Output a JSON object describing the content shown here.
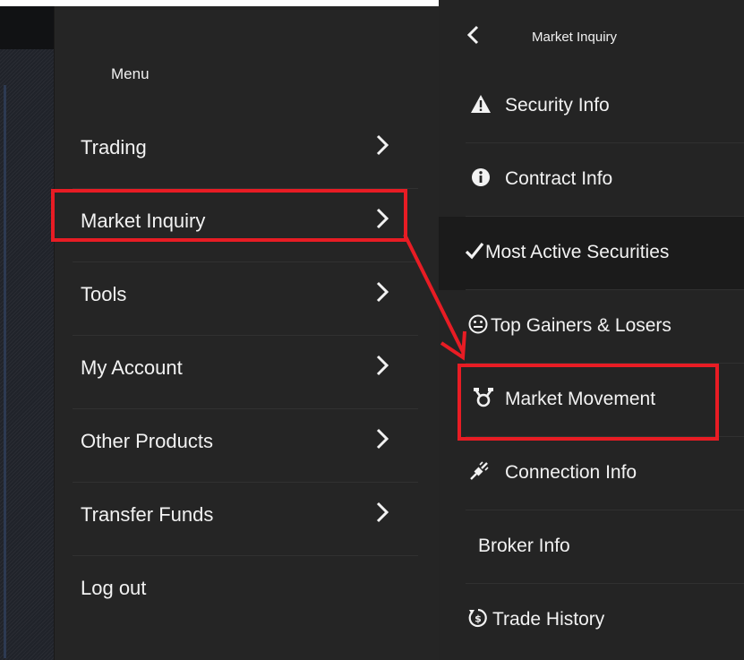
{
  "menu": {
    "title": "Menu",
    "items": [
      {
        "label": "Trading",
        "has_submenu": true
      },
      {
        "label": "Market Inquiry",
        "has_submenu": true,
        "highlighted": true
      },
      {
        "label": "Tools",
        "has_submenu": true
      },
      {
        "label": "My Account",
        "has_submenu": true
      },
      {
        "label": "Other Products",
        "has_submenu": true
      },
      {
        "label": "Transfer Funds",
        "has_submenu": true
      },
      {
        "label": "Log out",
        "has_submenu": false
      }
    ]
  },
  "submenu": {
    "title": "Market Inquiry",
    "back_icon": "chevron-left-icon",
    "items": [
      {
        "label": "Security Info",
        "icon": "warning-triangle-icon"
      },
      {
        "label": "Contract Info",
        "icon": "info-circle-icon"
      },
      {
        "label": "Most Active Securities",
        "icon": "checkmark-icon"
      },
      {
        "label": "Top Gainers & Losers",
        "icon": "smiley-icon"
      },
      {
        "label": "Market Movement",
        "icon": "movement-icon",
        "highlighted": true
      },
      {
        "label": "Connection Info",
        "icon": "plug-icon"
      },
      {
        "label": "Broker Info",
        "icon": ""
      },
      {
        "label": "Trade History",
        "icon": "history-dollar-icon"
      }
    ]
  },
  "colors": {
    "menu_bg": "#252525",
    "submenu_bg": "#242424",
    "text": "#f2f2f2",
    "annotation": "#e81c24"
  }
}
